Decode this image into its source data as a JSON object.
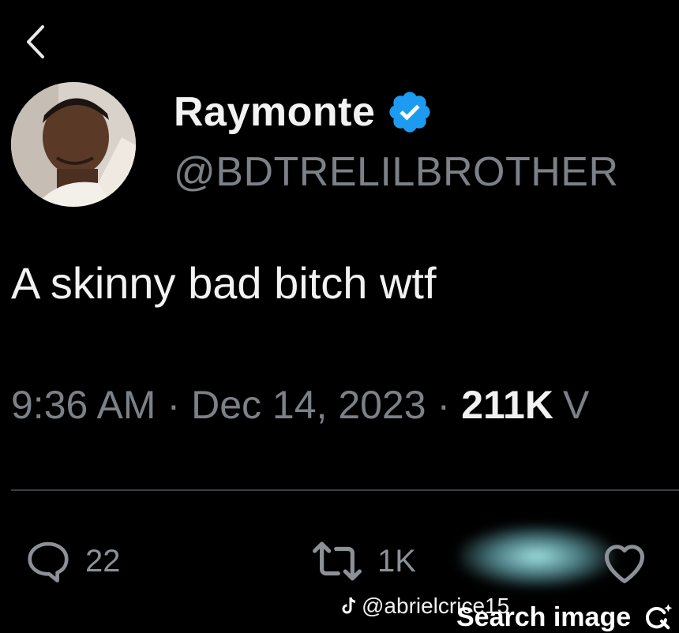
{
  "tweet": {
    "author_name": "Raymonte",
    "author_handle": "@BDTRELILBROTHER",
    "text": "A skinny bad bitch wtf",
    "time": "9:36 AM",
    "separator": "·",
    "date": "Dec 14, 2023",
    "views": "211K",
    "views_label_fragment": "V"
  },
  "actions": {
    "reply_count": "22",
    "retweet_count": "1K"
  },
  "overlay": {
    "watermark": "@abrielcrice15",
    "search_image_label": "Search image"
  },
  "icons": {
    "back": "chevron-left-icon",
    "verified": "verified-badge-icon",
    "reply": "reply-bubble-icon",
    "retweet": "retweet-icon",
    "like": "heart-icon",
    "tiktok": "tiktok-logo-icon",
    "search_image": "search-image-icon"
  },
  "colors": {
    "background": "#000000",
    "verified": "#1d9bf0",
    "secondary_text": "#7b8187"
  }
}
